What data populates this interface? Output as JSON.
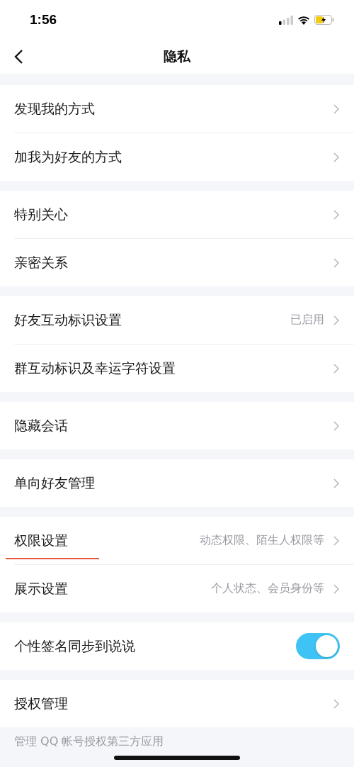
{
  "status_bar": {
    "time": "1:56"
  },
  "nav": {
    "title": "隐私"
  },
  "groups": [
    {
      "items": [
        {
          "kind": "link",
          "label": "发现我的方式",
          "highlighted": false
        },
        {
          "kind": "link",
          "label": "加我为好友的方式",
          "highlighted": false
        }
      ]
    },
    {
      "items": [
        {
          "kind": "link",
          "label": "特别关心",
          "highlighted": false
        },
        {
          "kind": "link",
          "label": "亲密关系",
          "highlighted": false
        }
      ]
    },
    {
      "items": [
        {
          "kind": "link",
          "label": "好友互动标识设置",
          "value": "已启用",
          "highlighted": false
        },
        {
          "kind": "link",
          "label": "群互动标识及幸运字符设置",
          "highlighted": false
        }
      ]
    },
    {
      "items": [
        {
          "kind": "link",
          "label": "隐藏会话",
          "highlighted": false
        }
      ]
    },
    {
      "items": [
        {
          "kind": "link",
          "label": "单向好友管理",
          "highlighted": false
        }
      ]
    },
    {
      "items": [
        {
          "kind": "link",
          "label": "权限设置",
          "value": "动态权限、陌生人权限等",
          "highlighted": true
        },
        {
          "kind": "link",
          "label": "展示设置",
          "value": "个人状态、会员身份等",
          "highlighted": false
        }
      ]
    },
    {
      "items": [
        {
          "kind": "toggle",
          "label": "个性签名同步到说说",
          "on": true
        }
      ]
    },
    {
      "items": [
        {
          "kind": "link",
          "label": "授权管理",
          "highlighted": false
        }
      ],
      "note": "管理 QQ 帐号授权第三方应用"
    }
  ]
}
